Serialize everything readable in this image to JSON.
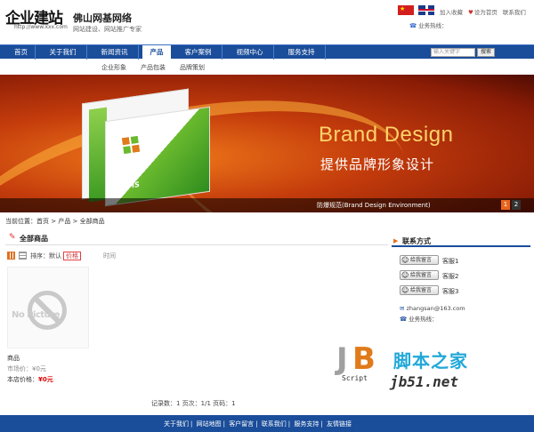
{
  "header": {
    "logo": "企业建站",
    "logo_url": "http://www.xxx.com",
    "site_name": "佛山网基网络",
    "slogan": "网站建设、网站推广专家",
    "top_links": [
      "加入收藏",
      "设为首页",
      "联系我们"
    ],
    "hotline": "业务热线："
  },
  "nav": {
    "items": [
      "首页",
      "关于我们",
      "新闻资讯",
      "产品",
      "客户案例",
      "视频中心",
      "服务支持"
    ],
    "active_index": 3,
    "search_placeholder": "输入关键字",
    "search_button": "搜索"
  },
  "subnav": [
    "企业形象",
    "产品包装",
    "品牌策划"
  ],
  "banner": {
    "title": "Brand Design",
    "subtitle": "提供品牌形象设计",
    "book_label": "VIS",
    "caption": "防爆规范(Brand Design Environment)",
    "pages": [
      "1",
      "2"
    ]
  },
  "breadcrumb": "当前位置：首页 > 产品 > 全部商品",
  "panel": {
    "title": "全部商品",
    "sort_label": "排序：默认",
    "price_label": "价格",
    "time_label": "时间"
  },
  "product": {
    "no_picture": "No Picture",
    "name": "商品",
    "market_price": "市场价：¥0元",
    "shop_price_label": "本店价格：",
    "shop_price": "¥0元"
  },
  "pagination": "记录数：1  页次：1/1  页码：1",
  "sidebar": {
    "title": "联系方式",
    "qq": [
      {
        "button": "给我留言",
        "label": "客服1"
      },
      {
        "button": "给我留言",
        "label": "客服2"
      },
      {
        "button": "给我留言",
        "label": "客服3"
      }
    ],
    "email": "zhangsan@163.com",
    "phone": "业务热线："
  },
  "watermark": {
    "script_text": "Script",
    "cn_text": "脚本之家",
    "url": "jb51.net"
  },
  "footer": [
    "关于我们",
    "网站地图",
    "客户留言",
    "联系我们",
    "服务支持",
    "友情链接"
  ],
  "colors": {
    "nav_blue": "#1a4d9a",
    "accent_orange": "#e07020",
    "price_red": "#d00000"
  }
}
